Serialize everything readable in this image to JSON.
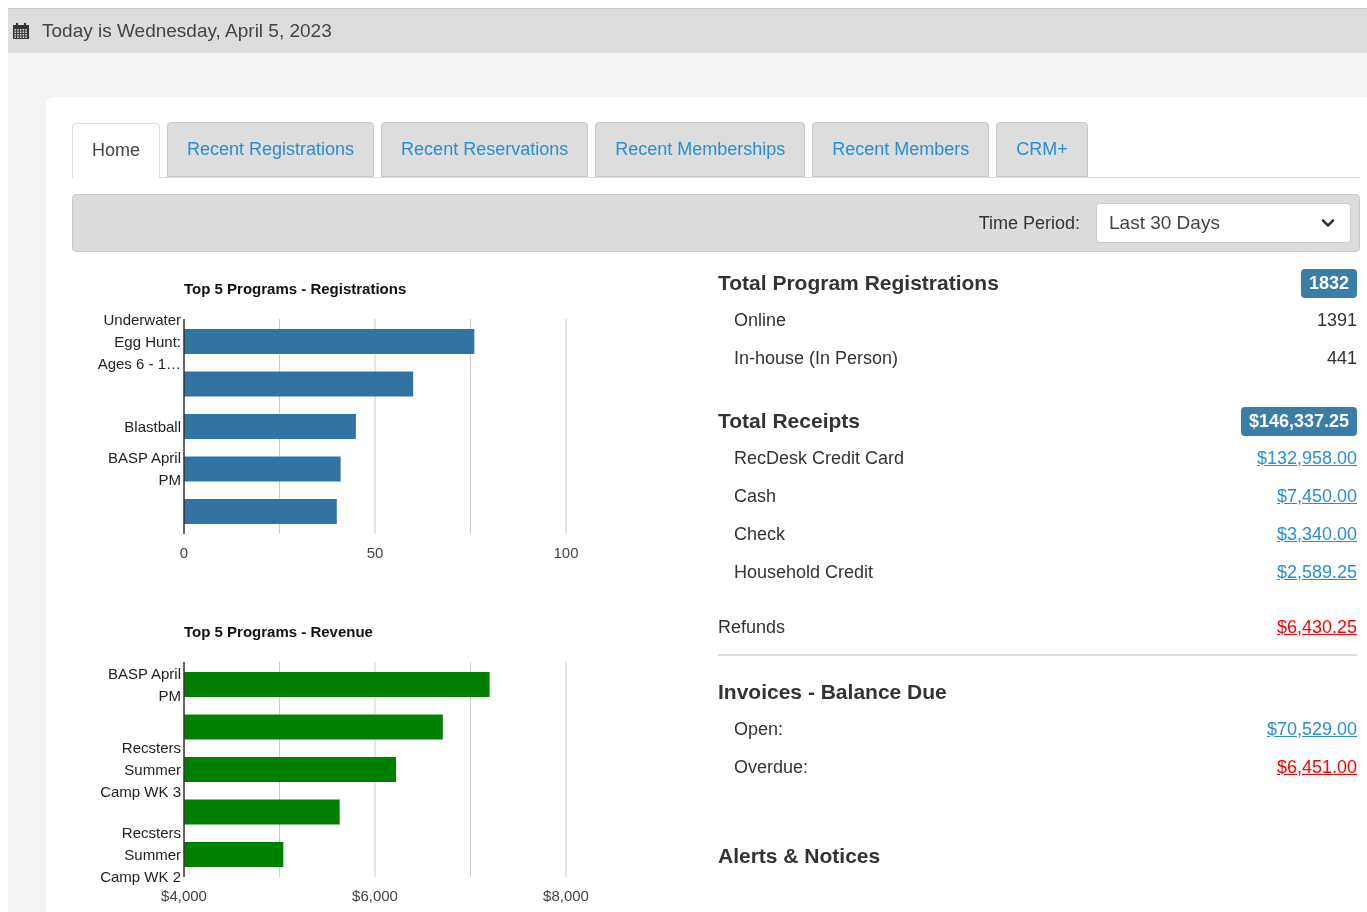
{
  "header": {
    "date_text": "Today is Wednesday, April 5, 2023"
  },
  "tabs": [
    {
      "label": "Home",
      "selected": true
    },
    {
      "label": "Recent Registrations",
      "selected": false
    },
    {
      "label": "Recent Reservations",
      "selected": false
    },
    {
      "label": "Recent Memberships",
      "selected": false
    },
    {
      "label": "Recent Members",
      "selected": false
    },
    {
      "label": "CRM+",
      "selected": false
    }
  ],
  "filter": {
    "label": "Time Period:",
    "value": "Last 30 Days"
  },
  "charts": [
    {
      "chart_data": {
        "type": "bar",
        "orientation": "horizontal",
        "title": "Top 5 Programs - Registrations",
        "categories": [
          "Underwater Egg Hunt: Ages 6 - 1…",
          null,
          "Blastball",
          "BASP April PM",
          null
        ],
        "series": [
          {
            "color": "#3274a1",
            "values": [
              76,
              60,
              45,
              41,
              40
            ]
          }
        ],
        "xlim": [
          0,
          100
        ],
        "xticks": [
          {
            "value": 0,
            "label": "0"
          },
          {
            "value": 50,
            "label": "50"
          },
          {
            "value": 100,
            "label": "100"
          }
        ]
      }
    },
    {
      "chart_data": {
        "type": "bar",
        "orientation": "horizontal",
        "title": "Top 5 Programs - Revenue",
        "categories": [
          "BASP April PM",
          null,
          "Recsters Summer Camp WK 3",
          null,
          "Recsters Summer Camp WK 2"
        ],
        "series": [
          {
            "color": "#008000",
            "values": [
              7200,
              6710,
              6220,
              5630,
              5040
            ]
          }
        ],
        "xlim": [
          4000,
          8000
        ],
        "xticks": [
          {
            "value": 4000,
            "label": "$4,000"
          },
          {
            "value": 6000,
            "label": "$6,000"
          },
          {
            "value": 8000,
            "label": "$8,000"
          }
        ]
      }
    }
  ],
  "registrations": {
    "title": "Total Program Registrations",
    "total": "1832",
    "rows": [
      {
        "label": "Online",
        "value": "1391",
        "kind": "plain"
      },
      {
        "label": "In-house (In Person)",
        "value": "441",
        "kind": "plain"
      }
    ]
  },
  "receipts": {
    "title": "Total Receipts",
    "total": "$146,337.25",
    "rows": [
      {
        "label": "RecDesk Credit Card",
        "value": "$132,958.00",
        "kind": "link"
      },
      {
        "label": "Cash",
        "value": "$7,450.00",
        "kind": "link"
      },
      {
        "label": "Check",
        "value": "$3,340.00",
        "kind": "link"
      },
      {
        "label": "Household Credit",
        "value": "$2,589.25",
        "kind": "link"
      }
    ]
  },
  "refunds": {
    "label": "Refunds",
    "value": "$6,430.25",
    "kind": "negative"
  },
  "invoices": {
    "title": "Invoices - Balance Due",
    "rows": [
      {
        "label": "Open:",
        "value": "$70,529.00",
        "kind": "link"
      },
      {
        "label": "Overdue:",
        "value": "$6,451.00",
        "kind": "negative"
      }
    ]
  },
  "alerts": {
    "title": "Alerts & Notices"
  }
}
